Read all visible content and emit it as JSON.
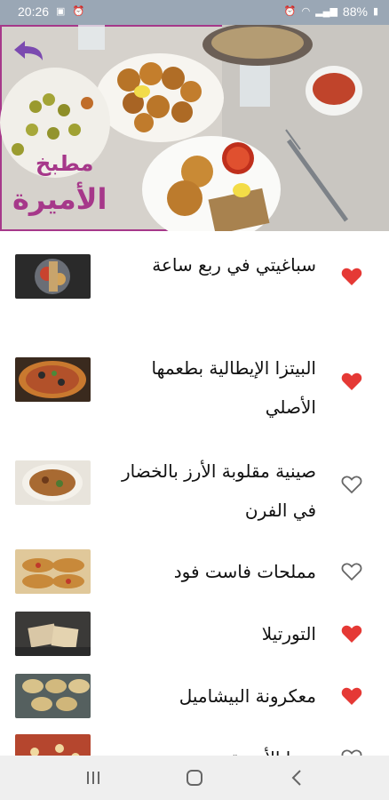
{
  "status": {
    "time": "20:26",
    "battery": "88%"
  },
  "header": {
    "logo_line1": "مطبخ",
    "logo_line2": "الأميرة"
  },
  "recipes": [
    {
      "title": "سباغيتي في ربع ساعة",
      "favorite": true
    },
    {
      "title": "البيتزا الإيطالية بطعمها الأصلي",
      "favorite": true
    },
    {
      "title": "صينية مقلوبة الأرز بالخضار في الفرن",
      "favorite": false
    },
    {
      "title": "مملحات فاست فود",
      "favorite": false
    },
    {
      "title": "التورتيلا",
      "favorite": true
    },
    {
      "title": "معكرونة البيشاميل",
      "favorite": true
    },
    {
      "title": "بيتزا الأميرة",
      "favorite": false
    }
  ],
  "colors": {
    "heart": "#e53935",
    "brand": "#a6388a",
    "status_bar": "#9aa7b5"
  }
}
